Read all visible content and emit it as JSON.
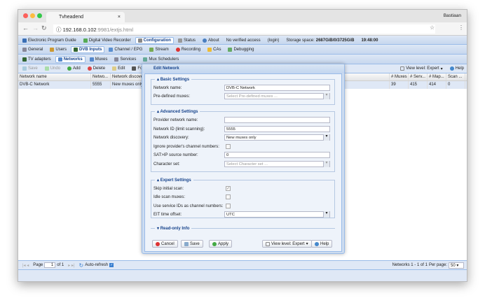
{
  "browser": {
    "tab_title": "Tvheadend",
    "user": "Bastiaan",
    "url_host": "192.168.0.102",
    "url_rest": ":9981/extjs.html"
  },
  "top_tabs": [
    "Electronic Program Guide",
    "Digital Video Recorder",
    "Configuration",
    "Status",
    "About"
  ],
  "status_bar": {
    "access": "No verified access",
    "login": "(login)",
    "storage_label": "Storage space:",
    "storage_value": "2687GiB/0/3725GiB",
    "time": "19:48:00"
  },
  "config_tabs": [
    "General",
    "Users",
    "DVB Inputs",
    "Channel / EPG",
    "Stream",
    "Recording",
    "CAs",
    "Debugging"
  ],
  "dvb_tabs": [
    "TV adapters",
    "Networks",
    "Muxes",
    "Services",
    "Mux Schedulers"
  ],
  "toolbar": {
    "save": "Save",
    "undo": "Undo",
    "add": "Add",
    "delete": "Delete",
    "edit": "Edit",
    "force_scan": "Force Scan",
    "view_level": "View level: Expert",
    "help": "Help"
  },
  "grid": {
    "columns": [
      "Network name",
      "Netwo...",
      "Network discover",
      "# Muxes",
      "# Serv...",
      "# Map...",
      "Scan ..."
    ],
    "rows": [
      {
        "name": "DVB-C Network",
        "id": "5555",
        "discovery": "New muxes only",
        "muxes": "39",
        "services": "415",
        "mapped": "414",
        "scan": "0"
      }
    ]
  },
  "paging": {
    "page_label": "Page",
    "page": "1",
    "of": "of 1",
    "auto_refresh": "Auto-refresh",
    "summary": "Networks 1 - 1 of 1",
    "per_page_label": "Per page:",
    "per_page": "50"
  },
  "dialog": {
    "title": "Edit Network",
    "basic": {
      "legend": "Basic Settings",
      "network_name_label": "Network name:",
      "network_name": "DVB-C Network",
      "predefined_label": "Pre-defined muxes:",
      "predefined_ph": "Select Pre-defined muxes ..."
    },
    "advanced": {
      "legend": "Advanced Settings",
      "provider_label": "Provider network name:",
      "provider": "",
      "netid_label": "Network ID (limit scanning):",
      "netid": "5555",
      "discovery_label": "Network discovery:",
      "discovery": "New muxes only",
      "ignore_label": "Ignore provider's channel numbers:",
      "satip_label": "SAT>IP source number:",
      "satip": "0",
      "charset_label": "Character set:",
      "charset_ph": "Select Character set ..."
    },
    "expert": {
      "legend": "Expert Settings",
      "skip_label": "Skip initial scan:",
      "skip": true,
      "idle_label": "Idle scan muxes:",
      "idle": false,
      "sid_label": "Use service IDs as channel numbers:",
      "sid": false,
      "eit_label": "EIT time offset:",
      "eit": "UTC"
    },
    "readonly": {
      "legend": "Read-only Info"
    },
    "buttons": {
      "cancel": "Cancel",
      "save": "Save",
      "apply": "Apply",
      "view_level": "View level: Expert",
      "help": "Help"
    }
  }
}
